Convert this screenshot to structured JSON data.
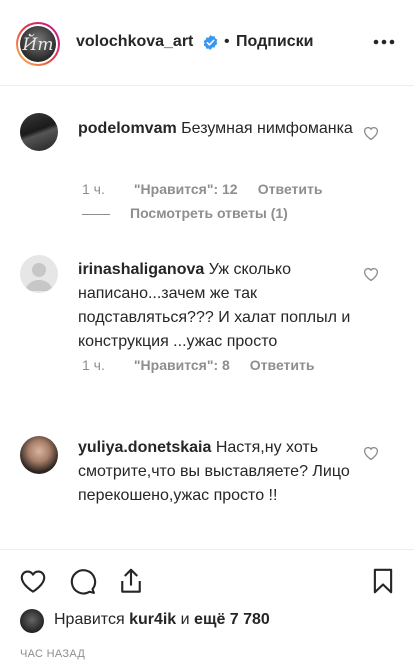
{
  "header": {
    "username": "volochkova_art",
    "dot": "•",
    "follow_label": "Подписки",
    "avatar_text": "Йт",
    "verified_icon": "verified-badge-icon",
    "more_icon": "more-options-icon"
  },
  "comments": [
    {
      "user": "podelomvam",
      "text": "Безумная нимфоманка",
      "time": "1 ч.",
      "likes": "\"Нравится\": 12",
      "reply": "Ответить",
      "view_replies": "Посмотреть ответы (1)"
    },
    {
      "user": "irinashaliganova",
      "text": "Уж сколько написано...зачем же так подставляться??? И халат поплыл и конструкция ...ужас просто",
      "time": "1 ч.",
      "likes": "\"Нравится\": 8",
      "reply": "Ответить"
    },
    {
      "user": "yuliya.donetskaia",
      "text": "Настя,ну хоть смотрите,что вы выставляете? Лицо перекошено,ужас просто !!"
    }
  ],
  "footer": {
    "liked_prefix": "Нравится",
    "liked_user": "kur4ik",
    "liked_and": "и",
    "liked_more": "ещё 7 780",
    "timestamp": "Час назад"
  },
  "colors": {
    "text": "#262626",
    "secondary": "#8e8e8e",
    "verified": "#3897f0",
    "divider": "#efefef"
  }
}
